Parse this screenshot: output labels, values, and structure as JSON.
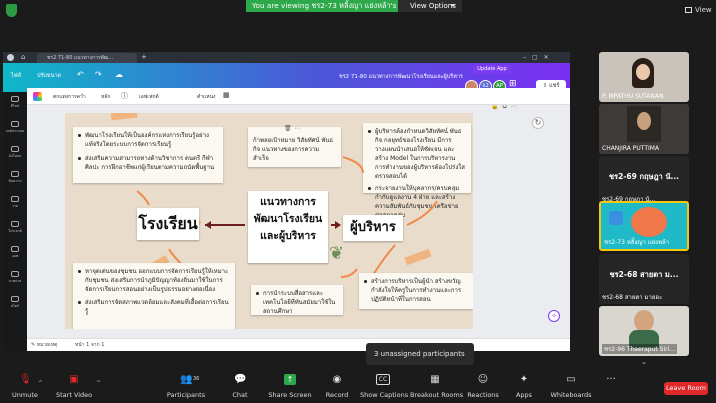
{
  "zoom": {
    "view_banner": "You are viewing ชร2-73 หลิ้งญา แย่งหล้า's screen",
    "view_options": "View Options",
    "view_button": "View"
  },
  "canva": {
    "tab_title": "ชร2 71-80 แนวทางการพัฒ...",
    "title": "ชร2 71-80 แนวทางการพัฒนาโรงเรียนและผู้บริหาร",
    "menu": [
      "ไฟล์",
      "ปรับขนาด"
    ],
    "update_button": "Update App",
    "share_button": "แชร์",
    "collaborators": [
      "จ2",
      "AP"
    ],
    "toolbar": [
      "ตกแต่งการคว่ำ",
      "หลัก",
      "เอฟเฟกต์",
      "ตำแหน่ง"
    ],
    "side_items": [
      "ดีไซน์",
      "องค์ประกอบ",
      "อัปโหลด",
      "ข้อความ",
      "วาด",
      "โปรเจกต์",
      "แอพ",
      "ภาพถ่าย",
      "สไตล์"
    ],
    "board": {
      "school_title": "โรงเรียน",
      "admin_title": "ผู้บริหาร",
      "center_title": "แนวทางการ\nพัฒนาโรงเรียน\nและผู้บริหาร",
      "note_top_left": [
        "พัฒนาโรงเรียนให้เป็นองค์กรแห่งการเรียนรู้อย่างแท้จริงโดยระบบการจัดการเรียนรู้",
        "ส่งเสริมความสามารถทางด้านวิชาการ ดนตรี กีฬา ศิลปะ การฝึกอาชีพแก่ผู้เรียนตามความถนัดพื้นฐาน"
      ],
      "note_top_center": "ก้าพลอเป้าหมาย วิสัยทัศน์ พันธกิจ แนวทางของการความสำเร็จ",
      "note_top_right": [
        "ผู้บริหารต้องกำหนดวิสัยทัศน์ พันธกิจ กลยุทธ์ของโรงเรียน มีการวางแผนนำเสนอให้ชัดเจน และสร้าง Model ในการบริหารงาน การทำงานของผู้บริหารต้องโปร่งใสตรวจสอบได้",
        "กระจายงานให้บุคลากร/ครบคลุม กำกับดูแลงาน 4 ฝ่าย และสร้างความสัมพันธ์กับชุมชน เครือข่ายต่อสภาคล่ม"
      ],
      "note_bottom_left": [
        "หาจุดเด่นของชุมชน ออกแบบการจัดการเรียนรู้ให้เหมาะกับชุมชน ส่งเสริมการนำภูมิปัญญาท้องถิ่นมาใช้ในการจัดการเรียนการสอนอย่างเป็นรูปธรรมอย่างต่อเนื่อง",
        "ส่งเสริมการจัดสภาพแวดล้อมและสังคมที่เอื้อต่อการเรียนรู้"
      ],
      "note_bottom_center": "การนำระบบสื่อสารและเทคโนโลยีที่ทันสมัยมาใช้ในสถานศึกษา",
      "note_bottom_right": "สร้างการบริหารเป็นผู้นำ สร้างขวัญกำลังใจให้ครูในการทำงานและการปฏิบัติหน้าที่ในการสอน"
    },
    "bottom": {
      "notes": "หมายเหตุ",
      "page": "หน้า 1 จาก 1"
    }
  },
  "participants_panel": [
    {
      "name": "P. MPATHU SUTANAN",
      "big": ""
    },
    {
      "name": "CHANJIRA PUTTIMA",
      "big": ""
    },
    {
      "name": "ชร2-69 กฤษฎา นั...",
      "big": "ชร2-69 กฤษฎา นั..."
    },
    {
      "name": "ชร2-73 หลิ้งญา แย่งหล้า",
      "big": ""
    },
    {
      "name": "ชร2-68 สายตา มายอะ",
      "big": "ชร2-68 สายตา ม..."
    },
    {
      "name": "ชร2-96 Thaeraput Siri...",
      "big": ""
    }
  ],
  "popup": "3 unassigned participants",
  "toolbar": {
    "unmute": "Unmute",
    "start_video": "Start Video",
    "participants": "Participants",
    "participants_count": "36",
    "chat": "Chat",
    "share_screen": "Share Screen",
    "record": "Record",
    "show_captions": "Show Captions",
    "breakout": "Breakout Rooms",
    "reactions": "Reactions",
    "apps": "Apps",
    "whiteboards": "Whiteboards",
    "leave": "Leave Room"
  },
  "colors": {
    "zoom_green": "#2da84a",
    "canva_purple": "#7d3cf3",
    "leave_red": "#e02828",
    "tape_orange": "#f0ad73"
  }
}
